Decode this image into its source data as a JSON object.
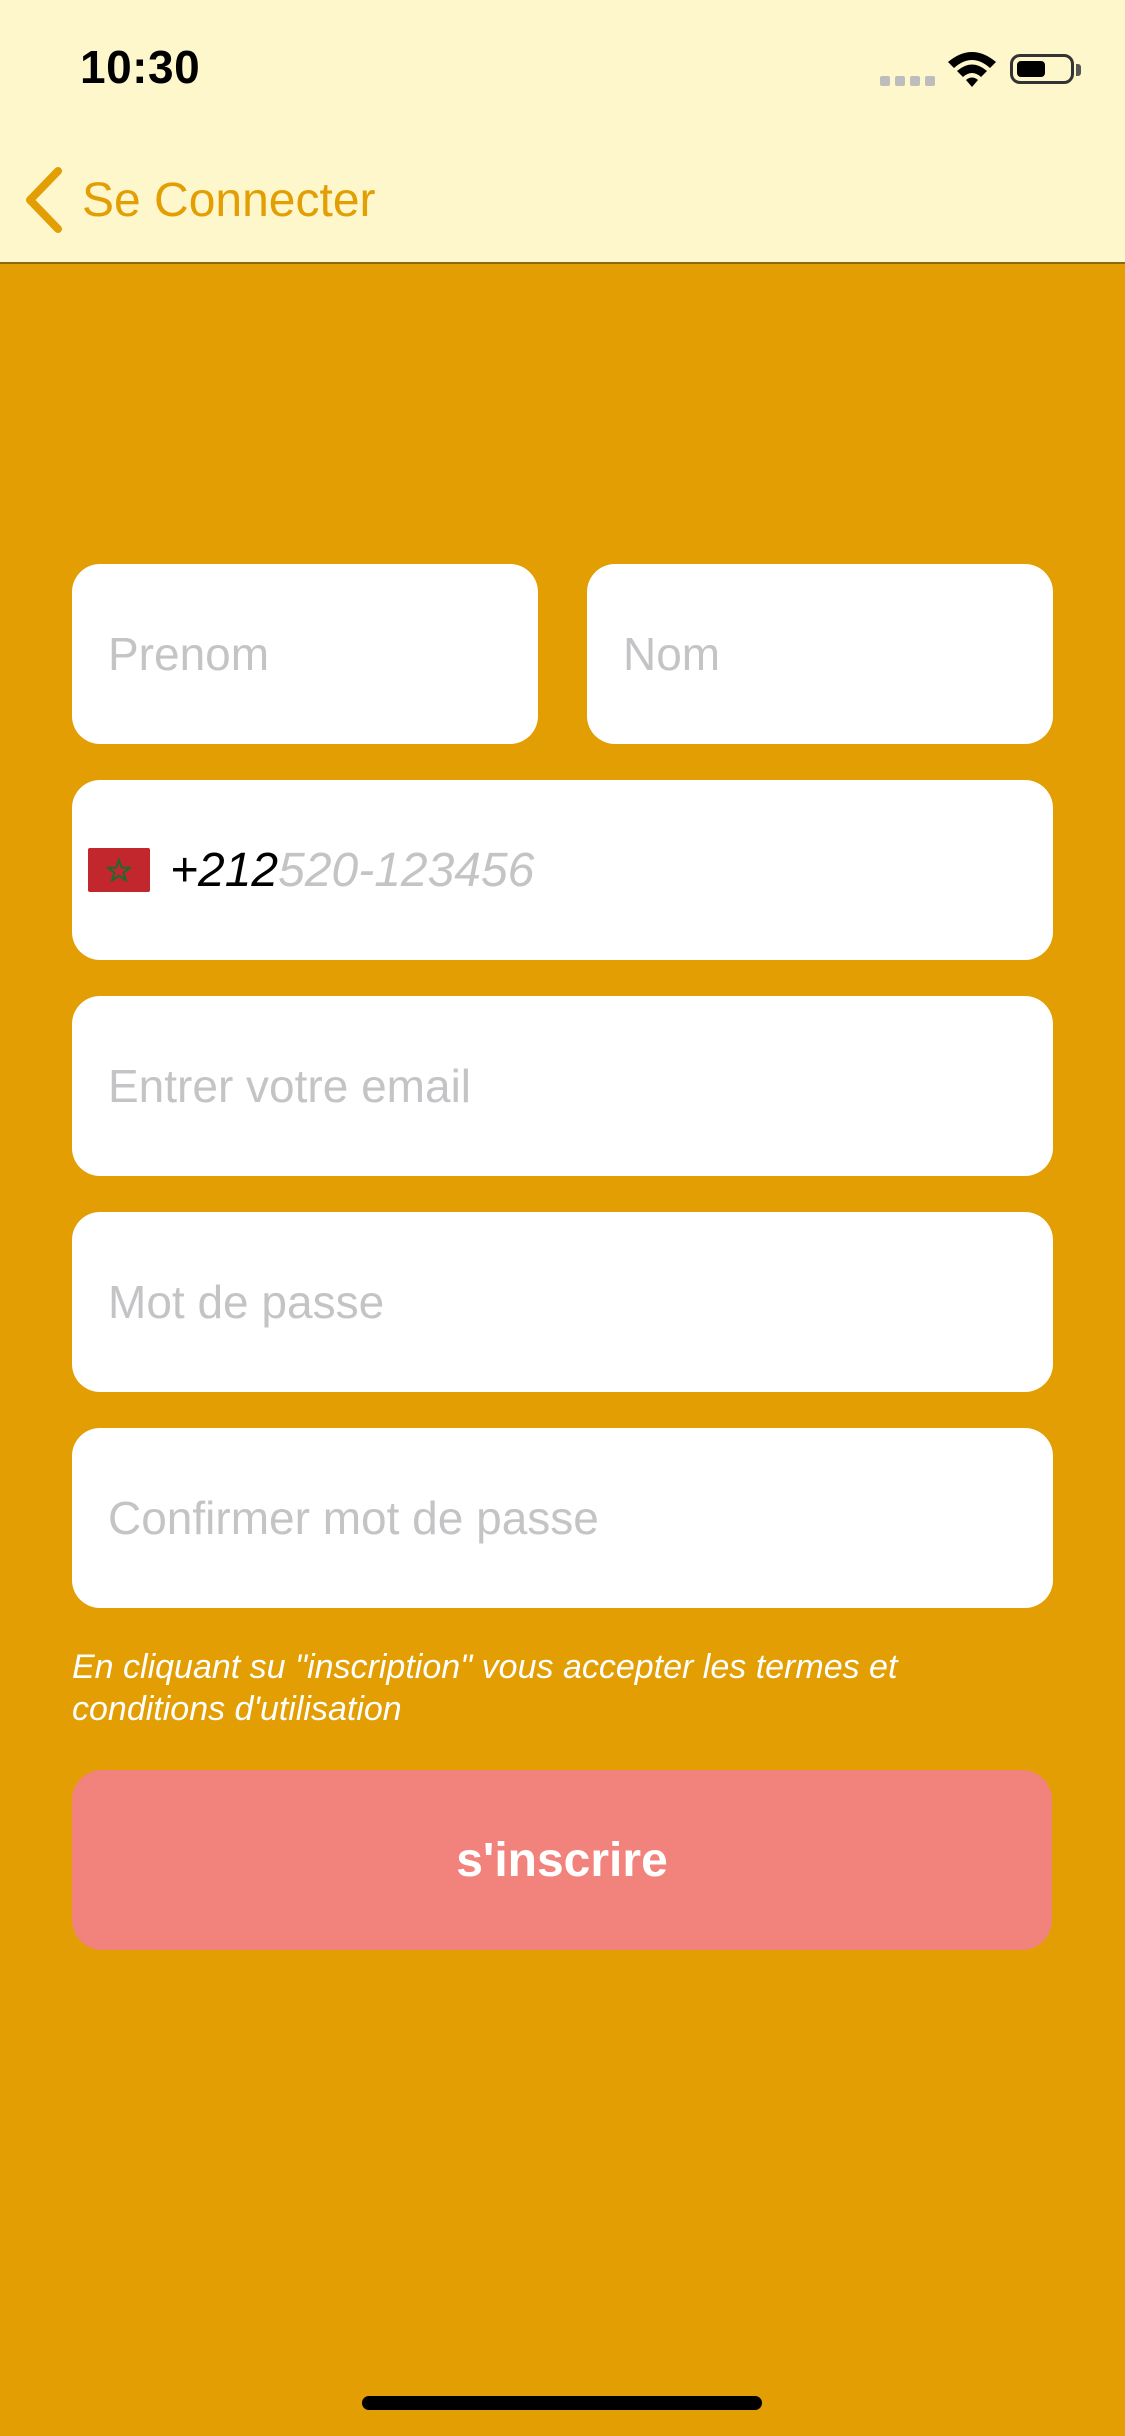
{
  "status_bar": {
    "time": "10:30",
    "battery_level": 0.55
  },
  "nav": {
    "back_label": "Se Connecter"
  },
  "form": {
    "first_name_placeholder": "Prenom",
    "last_name_placeholder": "Nom",
    "phone": {
      "flag": "morocco-flag",
      "dial_code": "+212",
      "placeholder": "520-123456"
    },
    "email_placeholder": "Entrer votre email",
    "password_placeholder": "Mot de passe",
    "confirm_password_placeholder": "Confirmer mot de passe",
    "terms_text": "En cliquant su \"inscription\" vous accepter les termes et conditions d'utilisation",
    "submit_label": "s'inscrire"
  },
  "colors": {
    "background": "#E29E02",
    "header_background": "#FEF7CB",
    "accent": "#E29E02",
    "submit_button": "#F2837C",
    "placeholder": "#C4C4C6"
  }
}
